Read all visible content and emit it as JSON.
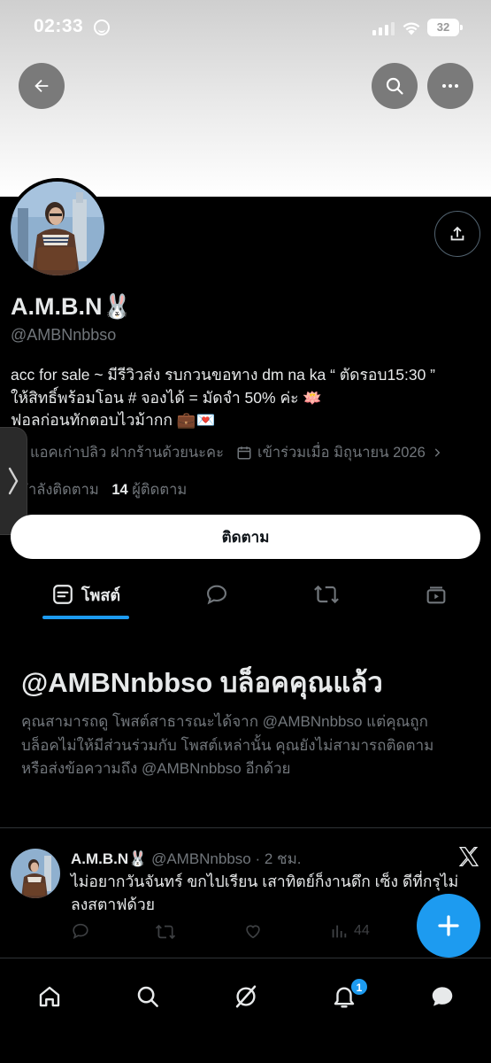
{
  "status_bar": {
    "time": "02:33",
    "battery": "32"
  },
  "profile": {
    "display_name": "A.M.B.N",
    "display_emoji": "🐰",
    "handle": "@AMBNnbbso",
    "bio_lines": [
      "acc for sale ~ มีรีวิวส่ง รบกวนขอทาง dm na ka “ ตัดรอบ15:30 ”",
      "ให้สิทธิ์พร้อมโอน # จองได้ = มัดจำ 50% ค่ะ 🪷",
      "ฟอลก่อนทักตอบไวม้ากก 💼💌"
    ],
    "location": "แอคเก่าปลิว ฝากร้านด้วยนะคะ",
    "joined": "เข้าร่วมเมื่อ มิถุนายน 2026",
    "following_label": "กำลังติดตาม",
    "followers_count": "14",
    "followers_label": "ผู้ติดตาม",
    "follow_button": "ติดตาม"
  },
  "tabs": {
    "posts_label": "โพสต์"
  },
  "blocked": {
    "title": "@AMBNnbbso บล็อคคุณแล้ว",
    "lines": [
      "คุณสามารถดู โพสต์สาธารณะได้จาก @AMBNnbbso แต่คุณถูก",
      "บล็อคไม่ให้มีส่วนร่วมกับ โพสต์เหล่านั้น คุณยังไม่สามารถติดตาม",
      "หรือส่งข้อความถึง @AMBNnbbso อีกด้วย"
    ]
  },
  "tweet": {
    "name": "A.M.B.N🐰",
    "meta": "@AMBNnbbso · 2 ชม.",
    "lines": [
      "ไม่อยากวันจันทร์ ขกไปเรียน เสาทิตย์ก็งานดึก เซ็ง ดีที่กรุไม่",
      "ลงสตาฟด้วย"
    ],
    "views": "44"
  },
  "bottom_nav": {
    "notification_count": "1"
  },
  "colors": {
    "accent": "#1d9bf0",
    "background": "#000000",
    "secondary_text": "#71767b"
  }
}
